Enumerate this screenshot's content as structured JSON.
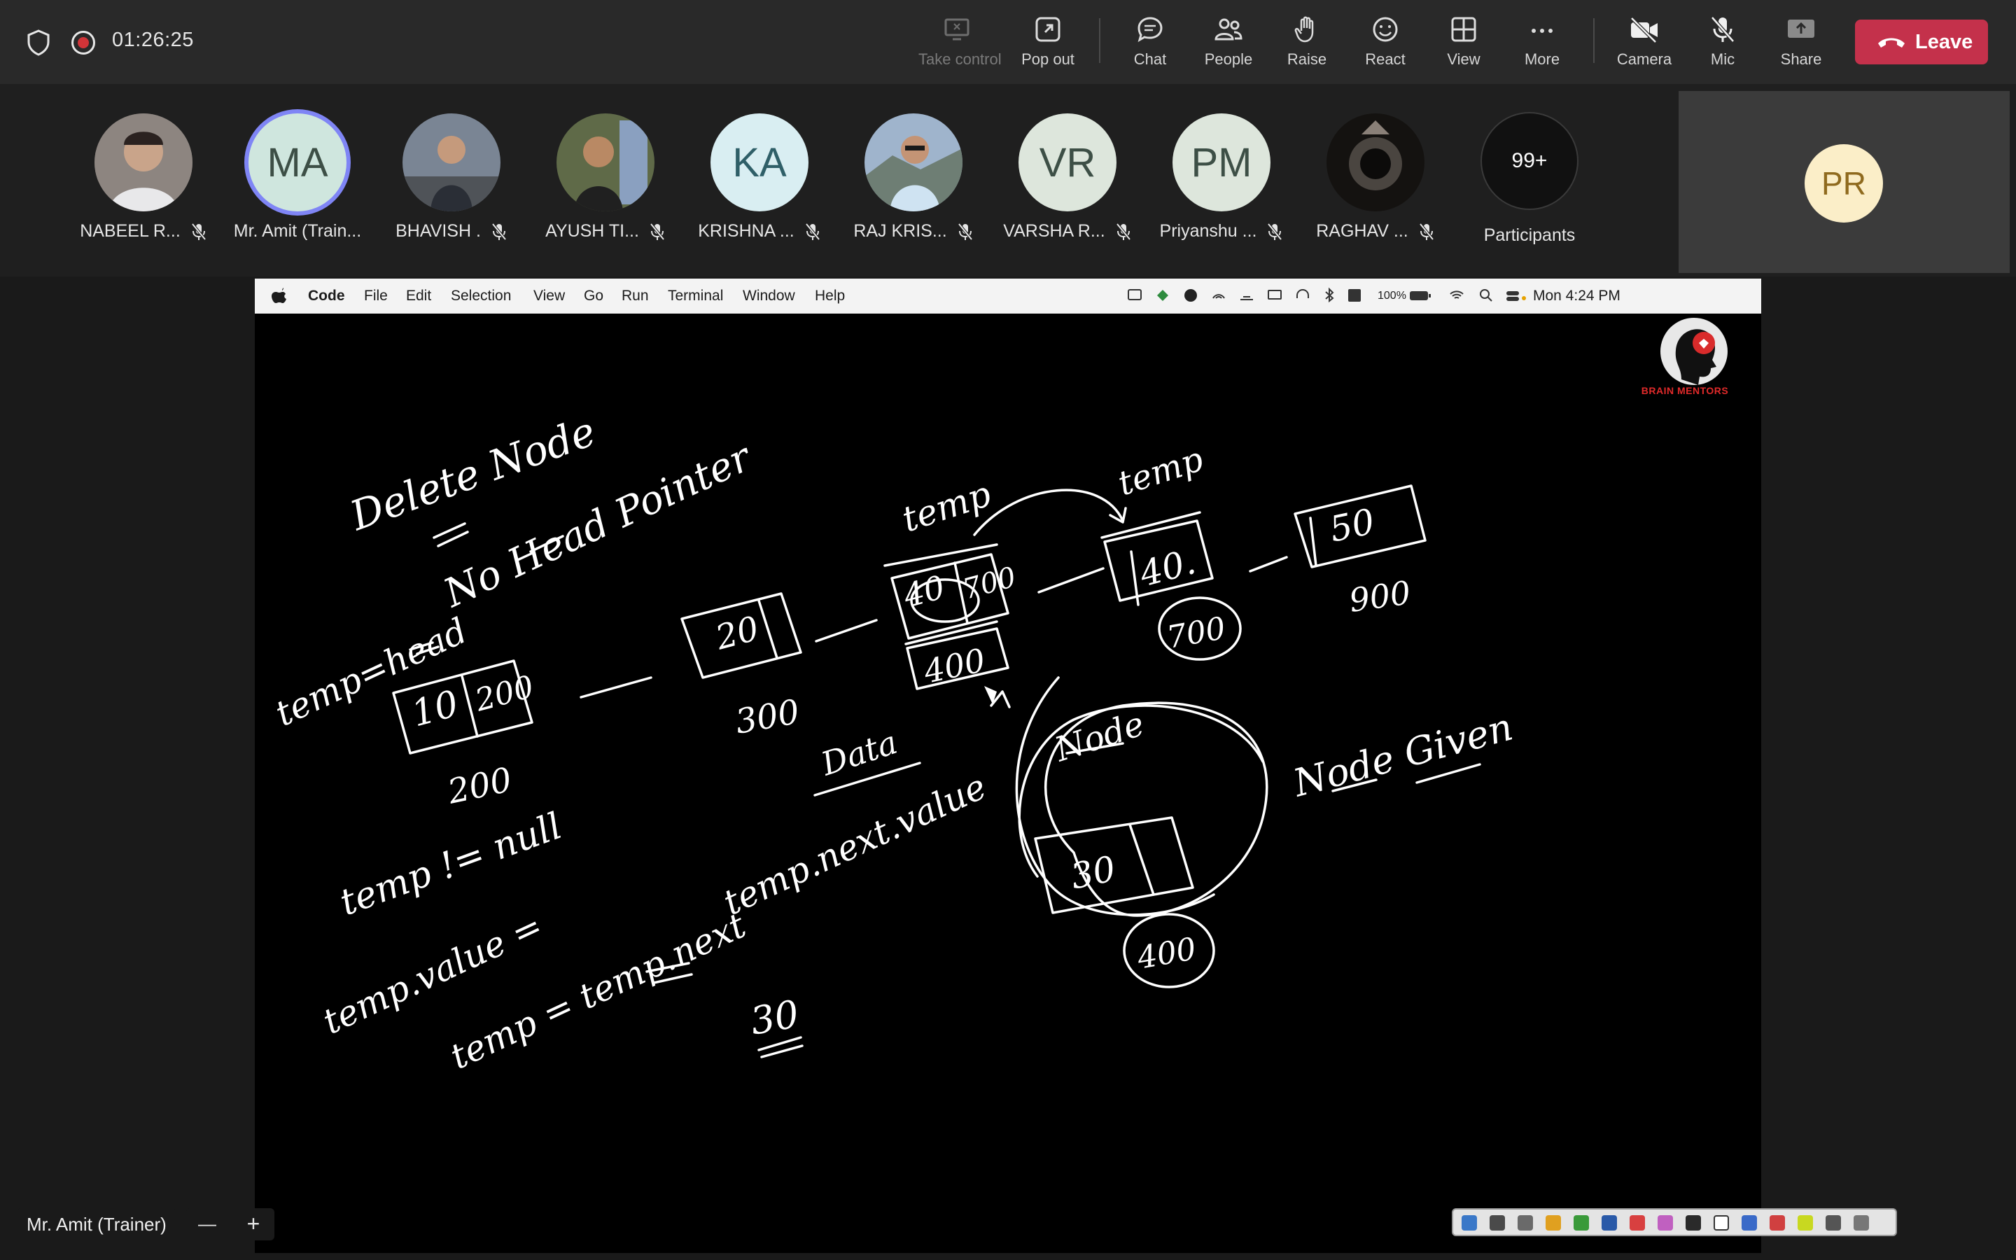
{
  "meeting": {
    "timer": "01:26:25"
  },
  "toolbar": {
    "take_control": "Take control",
    "pop_out": "Pop out",
    "chat": "Chat",
    "people": "People",
    "raise": "Raise",
    "react": "React",
    "view": "View",
    "more": "More",
    "camera": "Camera",
    "mic": "Mic",
    "share": "Share",
    "leave": "Leave"
  },
  "participants": [
    {
      "name": "NABEEL R...",
      "initials": "",
      "color": "#6f6a66"
    },
    {
      "name": "Mr. Amit (Train...",
      "initials": "MA",
      "color": "#cfe6de"
    },
    {
      "name": "BHAVISH .",
      "initials": "",
      "color": "#5a5f6a"
    },
    {
      "name": "AYUSH TI...",
      "initials": "",
      "color": "#4d5a44"
    },
    {
      "name": "KRISHNA ...",
      "initials": "KA",
      "color": "#d9eef2"
    },
    {
      "name": "RAJ KRIS...",
      "initials": "",
      "color": "#7d8fa8"
    },
    {
      "name": "VARSHA R...",
      "initials": "VR",
      "color": "#dde6dc"
    },
    {
      "name": "Priyanshu ...",
      "initials": "PM",
      "color": "#dde6dc"
    },
    {
      "name": "RAGHAV ...",
      "initials": "",
      "color": "#3a3630"
    }
  ],
  "more_participants": {
    "count": "99+",
    "label": "Participants"
  },
  "self": {
    "initials": "PR"
  },
  "mac_menu": {
    "app": "Code",
    "items": [
      "File",
      "Edit",
      "Selection",
      "View",
      "Go",
      "Run",
      "Terminal",
      "Window",
      "Help"
    ],
    "battery": "100%",
    "clock": "Mon 4:24 PM"
  },
  "logo": {
    "text": "BRAIN MENTORS"
  },
  "whiteboard": {
    "title": "Delete Node",
    "subtitle": "No Head Pointer",
    "notes": [
      "temp=head",
      "temp != null",
      "temp.value =",
      "temp = temp.next",
      "temp.next.value",
      "Data",
      "Node Given",
      "Node",
      "30"
    ],
    "nodes": [
      {
        "value": "10",
        "next": "200",
        "addr": "200"
      },
      {
        "value": "20",
        "next": "",
        "addr": "300"
      },
      {
        "value": "40",
        "next": "700",
        "addr": "400"
      },
      {
        "value": "40.",
        "next": "",
        "addr": "700"
      },
      {
        "value": "50",
        "next": "",
        "addr": "900"
      },
      {
        "value": "30",
        "next": "",
        "addr": "400"
      }
    ],
    "temp_labels": [
      "temp",
      "temp"
    ]
  },
  "presenter": {
    "name": "Mr. Amit (Trainer)"
  },
  "zoom": {
    "minus": "—",
    "plus": "+"
  }
}
